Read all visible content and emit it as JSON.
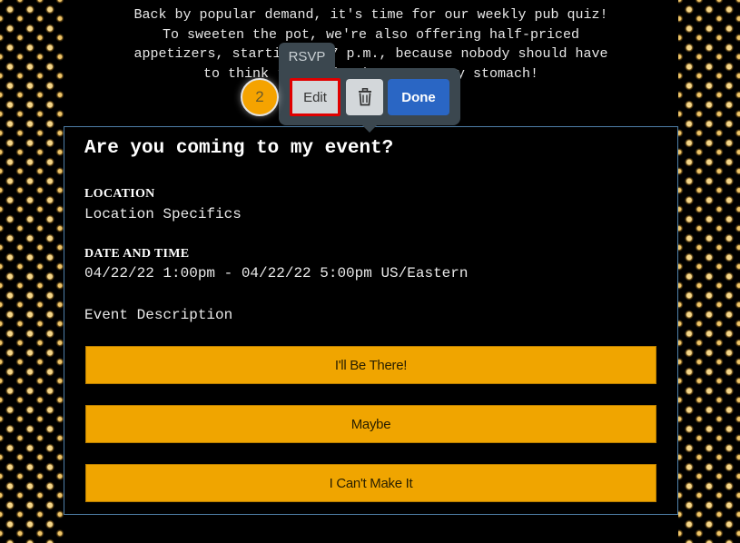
{
  "intro": {
    "lines": [
      "Back by popular demand, it's time for our weekly pub quiz!",
      "To sweeten the pot, we're also offering half-priced",
      "appetizers, starting at 7 p.m., because nobody should have",
      "to think really hard on an empty stomach!"
    ]
  },
  "toolbar": {
    "tab_label": "RSVP",
    "edit_label": "Edit",
    "trash_icon": "trash-icon",
    "done_label": "Done",
    "step_badge": "2",
    "colors": {
      "panel": "#3b474f",
      "done": "#2a66c4",
      "highlight": "#e00000",
      "badge": "#f5a300"
    }
  },
  "card": {
    "title": "Are you coming to my event?",
    "location_label": "LOCATION",
    "location_value": "Location Specifics",
    "datetime_label": "DATE AND TIME",
    "datetime_value": "04/22/22 1:00pm - 04/22/22 5:00pm US/Eastern",
    "description": "Event Description",
    "buttons": [
      {
        "label": "I'll Be There!"
      },
      {
        "label": "Maybe"
      },
      {
        "label": "I Can't Make It"
      }
    ],
    "colors": {
      "button": "#f0a500",
      "border": "#4f7fa8"
    }
  }
}
